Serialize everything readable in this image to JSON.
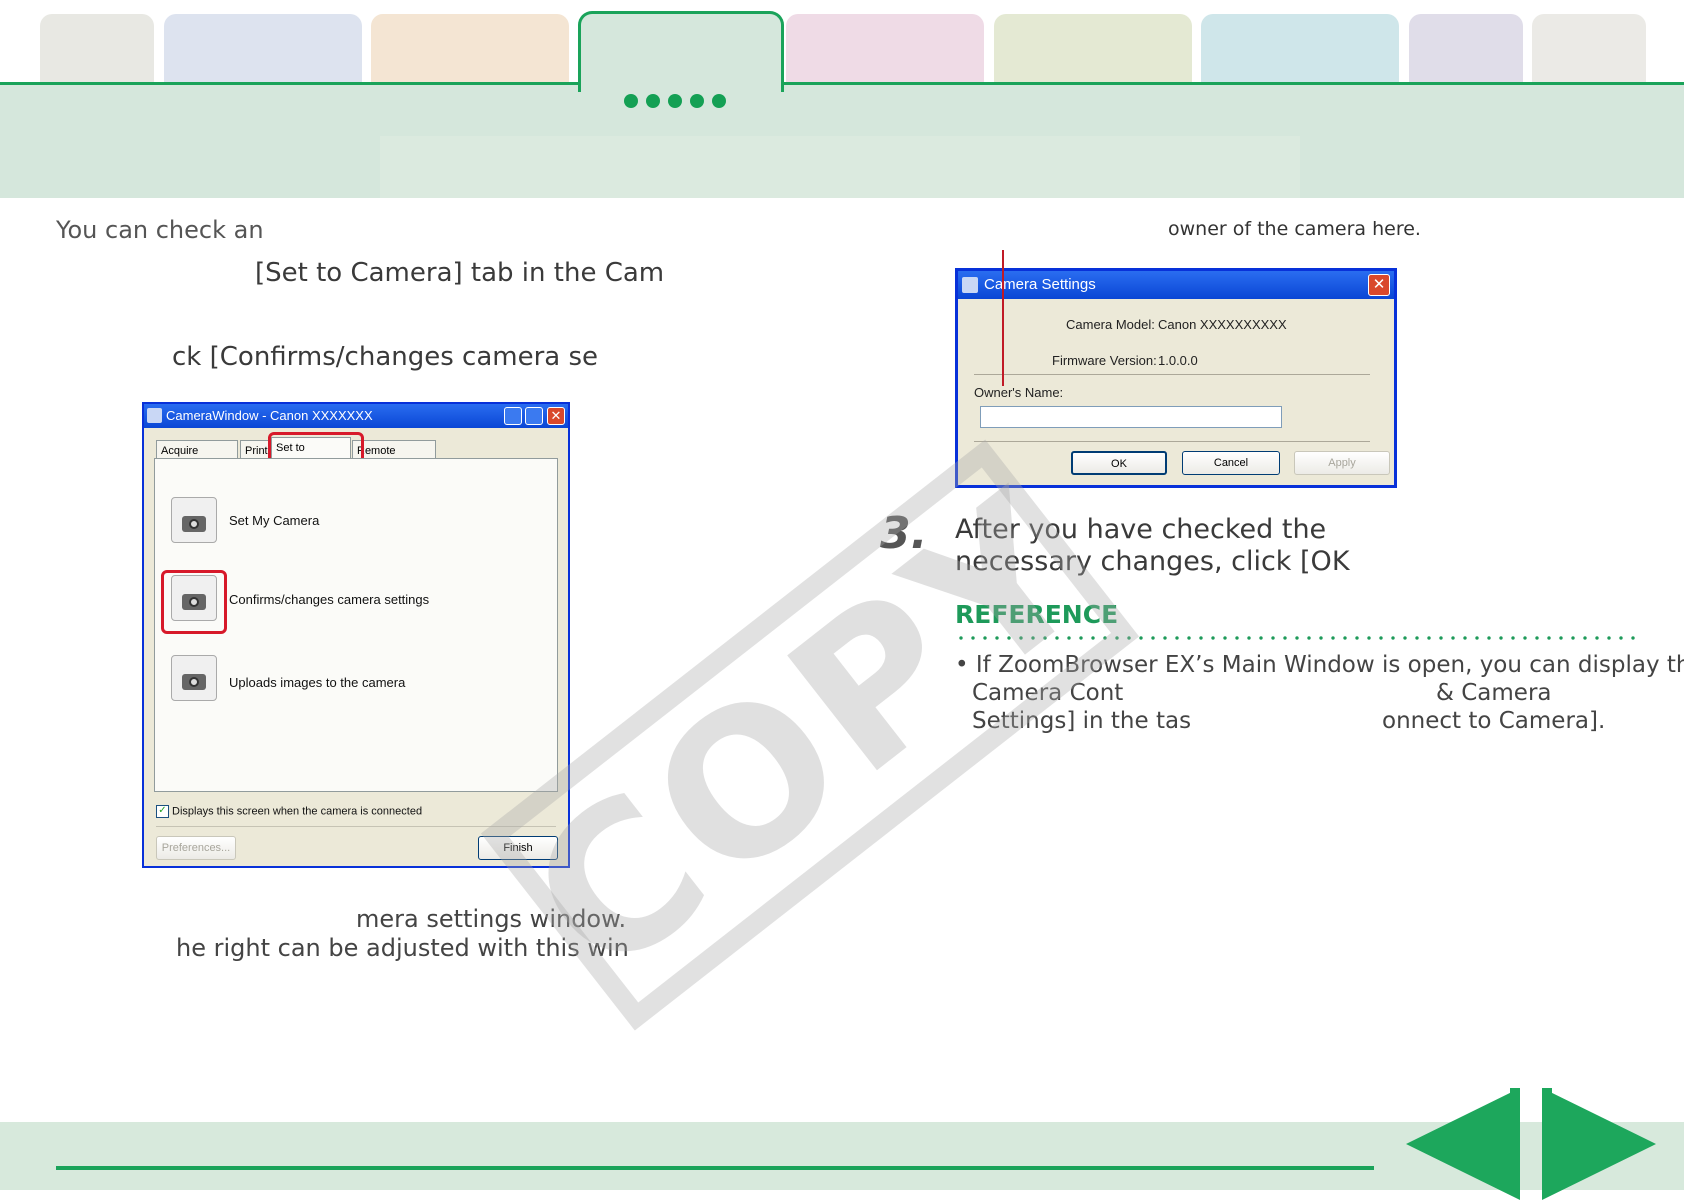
{
  "header": {
    "tabs": [
      {
        "color": "#e8e8e3"
      },
      {
        "color": "#dde3ef"
      },
      {
        "color": "#f4e5d3"
      },
      {
        "color": "#d5e7dc",
        "active": true
      },
      {
        "color": "#efdbe6"
      },
      {
        "color": "#e4e9d3"
      },
      {
        "color": "#cfe6ea"
      },
      {
        "color": "#e0dde9"
      },
      {
        "color": "#ebeae6"
      }
    ],
    "accent": "#1aa35a",
    "page_dots": 5
  },
  "body": {
    "intro_line": "You can check an",
    "intro_line2": "[Set to Camera] tab in the Cam",
    "step2_line": "ck [Confirms/changes camera se",
    "caption_line1": "mera settings window.",
    "caption_line2": "he right can be adjusted with this win",
    "owner_note": "owner of the camera here.",
    "step3_number": "3.",
    "step3_line1": "After you have checked the",
    "step3_line2": "necessary changes, click [OK",
    "reference_title": "REFERENCE",
    "reference_line1": "• If ZoomBrowser EX’s Main Window is open, you can display the",
    "reference_line2a": "Camera Cont",
    "reference_line2b": "& Camera",
    "reference_line3a": "Settings] in the tas",
    "reference_line3b": "onnect to Camera]."
  },
  "camera_window": {
    "title": "CameraWindow - Canon XXXXXXX",
    "tabs": [
      "Acquire Images",
      "Print",
      "Set to Camera",
      "Remote shooting"
    ],
    "active_tab": "Set to Camera",
    "options": [
      {
        "label": "Set My Camera",
        "icon": "set-my-camera-icon"
      },
      {
        "label": "Confirms/changes camera settings",
        "icon": "camera-settings-icon"
      },
      {
        "label": "Uploads images to the camera",
        "icon": "upload-images-icon"
      }
    ],
    "checkbox_label": "Displays this screen when the camera is connected",
    "checkbox_checked": true,
    "preferences_label": "Preferences...",
    "finish_label": "Finish",
    "highlight_color": "#d7192a"
  },
  "camera_settings": {
    "title": "Camera Settings",
    "model_label": "Camera Model:",
    "model_value": "Canon XXXXXXXXXX",
    "firmware_label": "Firmware Version:",
    "firmware_value": "1.0.0.0",
    "owner_label": "Owner's Name:",
    "owner_value": "",
    "ok_label": "OK",
    "cancel_label": "Cancel",
    "apply_label": "Apply"
  },
  "watermark": "COPY",
  "footer": {
    "prev_icon": "previous-page-arrow",
    "next_icon": "next-page-arrow"
  }
}
